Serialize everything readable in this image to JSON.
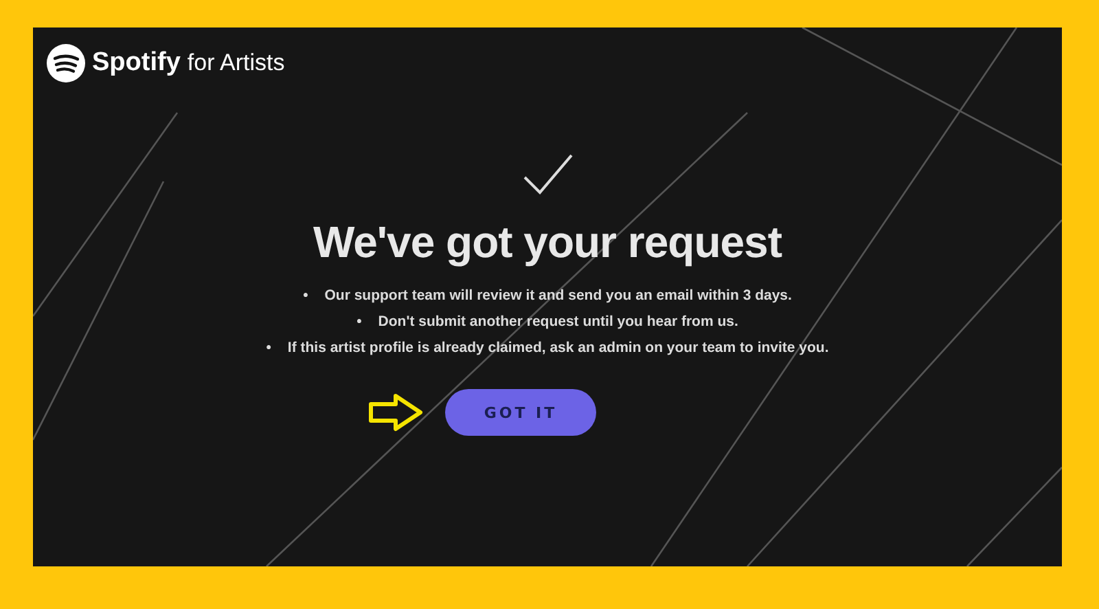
{
  "header": {
    "brand": "Spotify",
    "brand_suffix": "for Artists"
  },
  "title": "We've got your request",
  "bullets": [
    {
      "bullet": "•",
      "text": "Our support team will review it and send you an email within **3 days.**"
    },
    {
      "bullet": "•",
      "text": "Don't submit another request until you hear from us."
    },
    {
      "bullet": "•",
      "text": "If this artist profile is already claimed, ask an admin on your team to invite you."
    }
  ],
  "button": {
    "label": "GOT IT"
  }
}
